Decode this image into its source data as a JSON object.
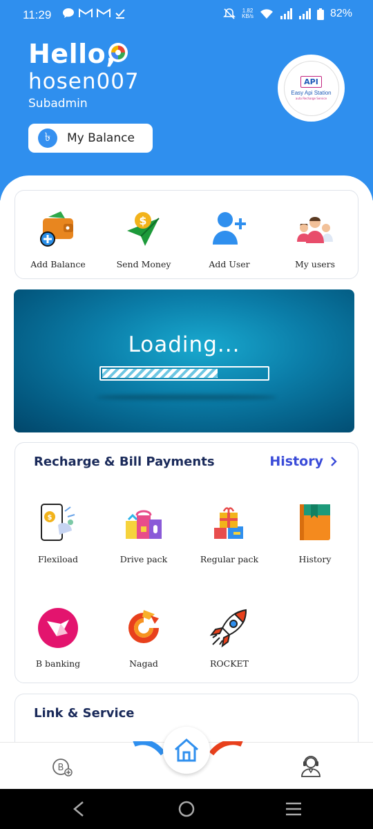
{
  "status_bar": {
    "time": "11:29",
    "net_speed_value": "1.82",
    "net_speed_unit": "KB/s",
    "battery": "82%"
  },
  "header": {
    "greeting": "Hello,",
    "username": "hosen007",
    "role": "Subadmin",
    "balance_button": "My Balance",
    "taka_symbol": "৳",
    "logo": {
      "badge": "API",
      "name": "Easy Api Station",
      "tagline": "auto Recharge Service"
    }
  },
  "quick_actions": [
    {
      "label": "Add Balance",
      "icon": "wallet-add-icon"
    },
    {
      "label": "Send Money",
      "icon": "send-money-icon"
    },
    {
      "label": "Add User",
      "icon": "add-user-icon"
    },
    {
      "label": "My users",
      "icon": "users-group-icon"
    }
  ],
  "banner": {
    "text": "Loading...",
    "progress": 0.7
  },
  "recharge_section": {
    "title": "Recharge & Bill Payments",
    "link": "History",
    "items": [
      {
        "label": "Flexiload",
        "icon": "flexiload-icon"
      },
      {
        "label": "Drive pack",
        "icon": "drive-pack-icon"
      },
      {
        "label": "Regular pack",
        "icon": "regular-pack-icon"
      },
      {
        "label": "History",
        "icon": "history-book-icon"
      },
      {
        "label": "B banking",
        "icon": "bkash-icon"
      },
      {
        "label": "Nagad",
        "icon": "nagad-icon"
      },
      {
        "label": "ROCKET",
        "icon": "rocket-icon"
      }
    ]
  },
  "link_section": {
    "title": "Link & Service"
  },
  "colors": {
    "header_blue": "#2f8fee",
    "title_navy": "#1a2a5a",
    "link_blue": "#3a4bd8"
  }
}
